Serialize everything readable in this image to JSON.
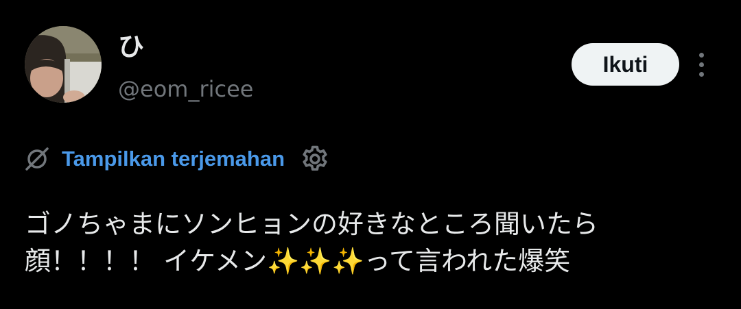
{
  "author": {
    "display_name": "ひ",
    "handle": "@eom_ricee",
    "avatar_icon": "profile-photo"
  },
  "actions": {
    "follow_label": "Ikuti",
    "more_icon": "vertical-ellipsis-icon"
  },
  "translation": {
    "label": "Tampilkan terjemahan",
    "icon": "no-translate-icon",
    "settings_icon": "gear-icon"
  },
  "tweet": {
    "text_line1": "ゴノちゃまにソンヒョンの好きなところ聞いたら",
    "text_line2": "顔！！！！ イケメン✨✨✨って言われた爆笑"
  },
  "colors": {
    "background": "#000000",
    "primary_text": "#e7e9ea",
    "secondary_text": "#71767b",
    "link": "#4a99e9",
    "follow_button_bg": "#eff3f4"
  }
}
